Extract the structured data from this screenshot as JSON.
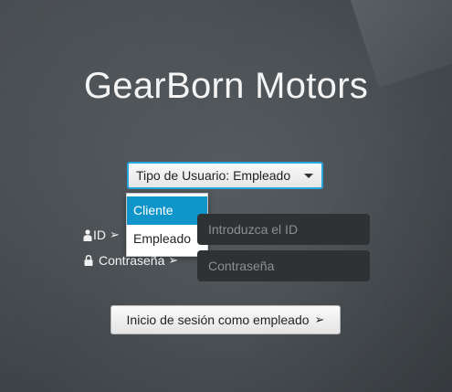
{
  "app": {
    "title": "GearBorn Motors"
  },
  "user_type": {
    "selected_label": "Tipo de Usuario: Empleado",
    "options": [
      "Cliente",
      "Empleado"
    ],
    "highlighted_option": "Cliente"
  },
  "login_form": {
    "id_label": "ID",
    "id_placeholder": "Introduzca el ID",
    "password_label": "Contraseña",
    "password_placeholder": "Contraseña",
    "label_arrow": "➢"
  },
  "submit": {
    "label": "Inicio de sesión como empleado",
    "arrow": "➢"
  },
  "colors": {
    "accent": "#2aa7dc",
    "selected_option": "#0f95c9",
    "field_background": "#2f3234"
  },
  "icons": {
    "id_label": "person-icon",
    "password_label": "lock-icon",
    "dropdown": "caret-down-icon"
  }
}
